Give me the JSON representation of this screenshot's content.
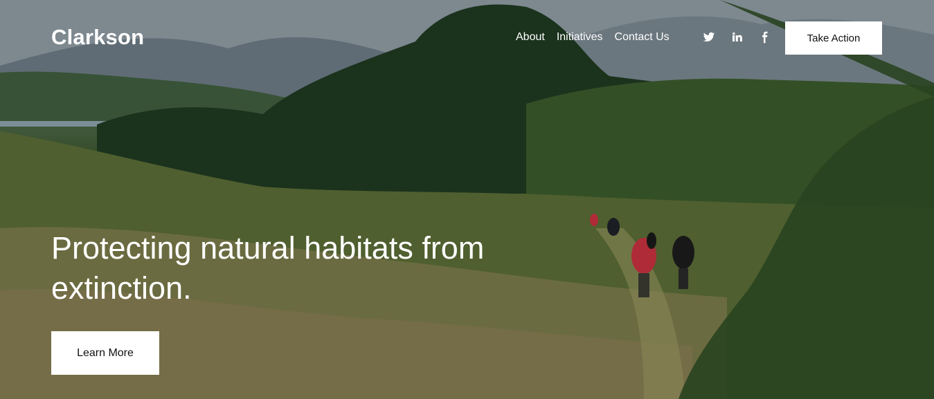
{
  "brand": {
    "name": "Clarkson"
  },
  "nav": {
    "items": [
      {
        "label": "About"
      },
      {
        "label": "Initiatives"
      },
      {
        "label": "Contact Us"
      }
    ]
  },
  "social": {
    "icons": [
      "twitter-icon",
      "linkedin-icon",
      "facebook-icon"
    ]
  },
  "header": {
    "cta_label": "Take Action"
  },
  "hero": {
    "headline": "Protecting natural habitats from extinction.",
    "button_label": "Learn More"
  },
  "colors": {
    "text": "#ffffff",
    "button_bg": "#ffffff",
    "button_text": "#111111"
  }
}
